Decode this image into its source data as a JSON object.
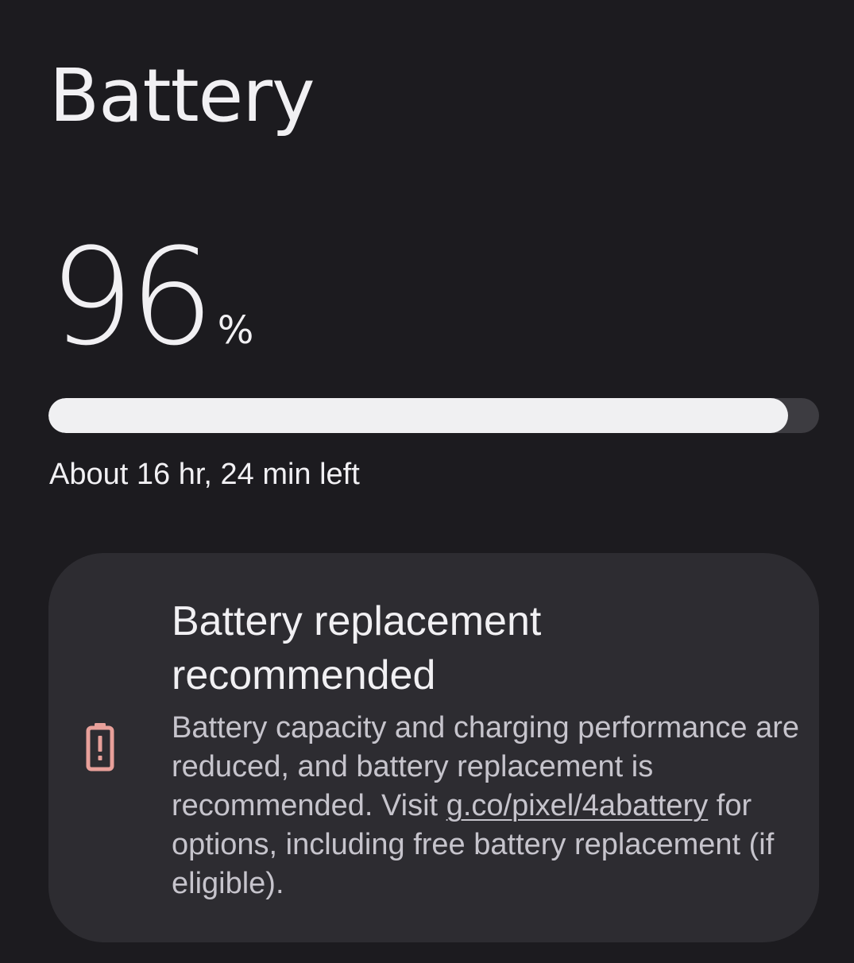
{
  "page": {
    "title": "Battery"
  },
  "battery": {
    "level_value": "96",
    "level_unit": "%",
    "level_fraction": 0.96,
    "time_left": "About 16 hr, 24 min left"
  },
  "colors": {
    "background": "#1c1b1f",
    "bar_fill": "#f0f0f2",
    "bar_track": "#3d3c41",
    "card_background": "#2d2c31",
    "warning_icon": "#e8a09a"
  },
  "alert_card": {
    "icon": "battery-alert-icon",
    "title": "Battery replacement recommended",
    "body_before_link": "Battery capacity and charging performance are reduced, and battery replacement is recommended. Visit ",
    "link_text": "g.co/pixel/4abattery",
    "body_after_link": " for options, including free battery replacement (if eligible)."
  }
}
